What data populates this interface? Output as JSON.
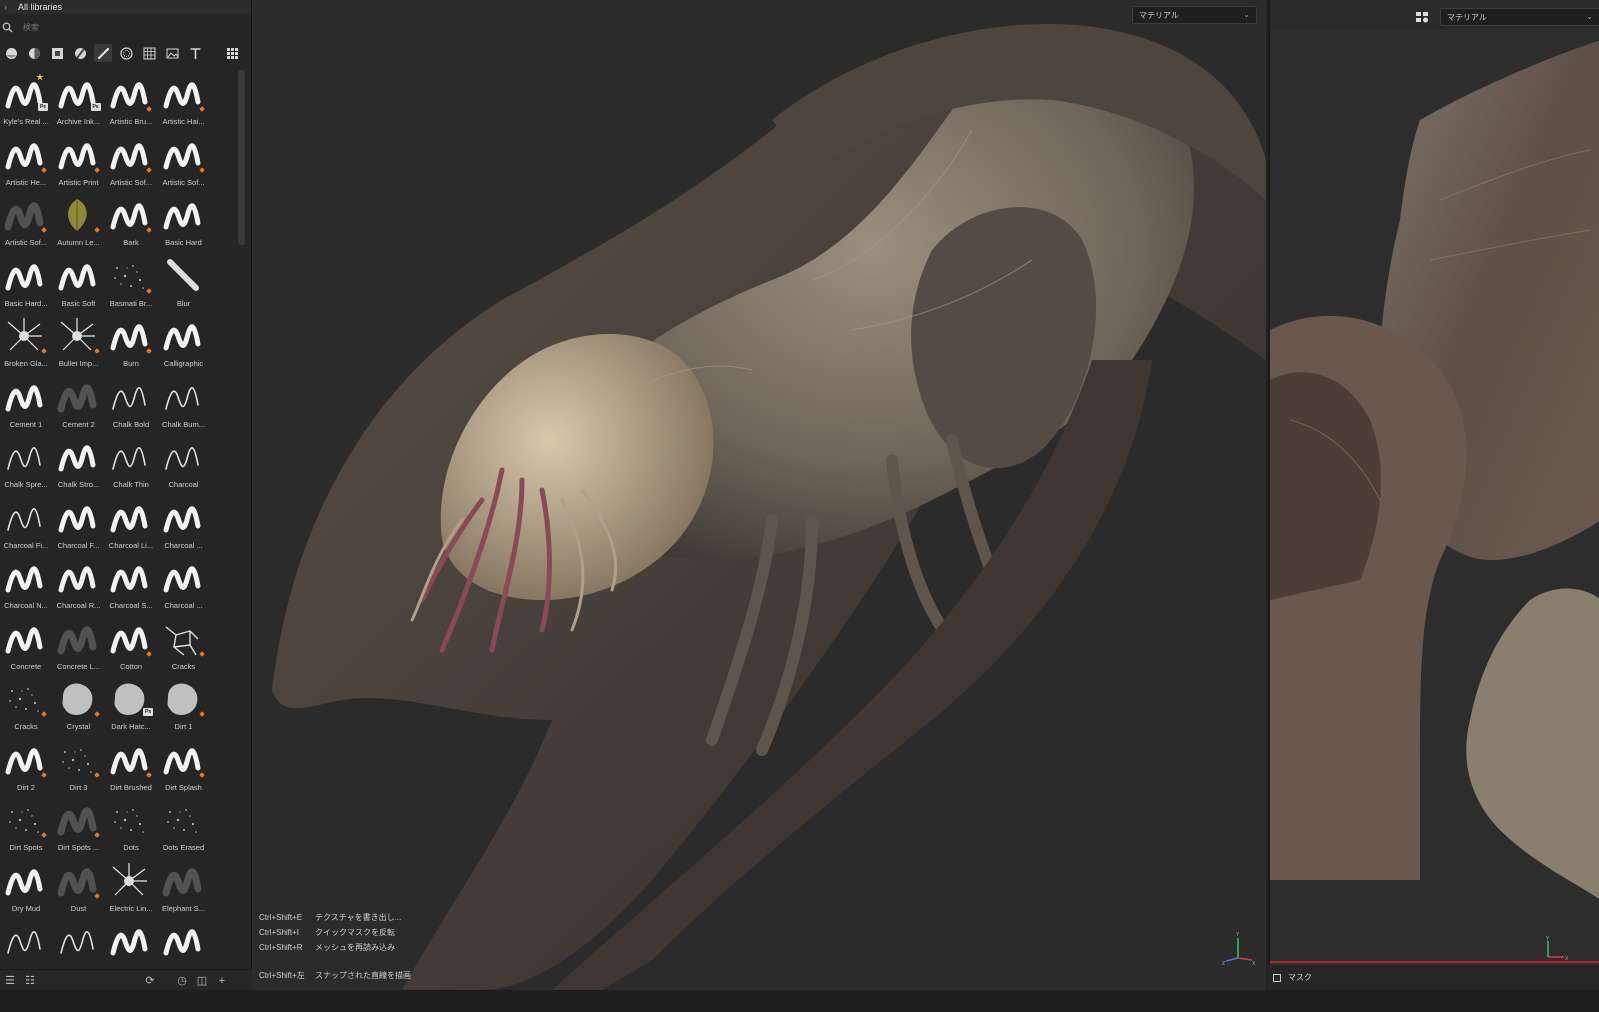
{
  "library": {
    "header": "All libraries",
    "search_placeholder": "検索",
    "tools": [
      "sphere-icon",
      "material-icon",
      "texture-icon",
      "smart-material-icon",
      "brush-icon",
      "stencil-icon",
      "grid-fill-icon",
      "image-icon",
      "text-icon"
    ],
    "items": [
      {
        "label": "Kyle's Real ...",
        "glyph": "wave",
        "badge": "ps",
        "star": true
      },
      {
        "label": "Archive Ink...",
        "glyph": "wave",
        "badge": "ps"
      },
      {
        "label": "Artistic Bru...",
        "glyph": "wave",
        "badge": "orange"
      },
      {
        "label": "Artistic Hai...",
        "glyph": "wave",
        "badge": "orange"
      },
      {
        "label": "Artistic He...",
        "glyph": "wave",
        "badge": "orange"
      },
      {
        "label": "Artistic Print",
        "glyph": "wave",
        "badge": "orange"
      },
      {
        "label": "Artistic Sof...",
        "glyph": "wave",
        "badge": "orange"
      },
      {
        "label": "Artistic Sof...",
        "glyph": "wave",
        "badge": "orange"
      },
      {
        "label": "Artistic Sof...",
        "glyph": "blur",
        "badge": "orange"
      },
      {
        "label": "Autumn Le...",
        "glyph": "leaf",
        "badge": "orange"
      },
      {
        "label": "Bark",
        "glyph": "wave",
        "badge": "orange"
      },
      {
        "label": "Basic Hard",
        "glyph": "wave",
        "badge": "none"
      },
      {
        "label": "Basic Hard...",
        "glyph": "wave",
        "badge": "none"
      },
      {
        "label": "Basic Soft",
        "glyph": "wave",
        "badge": "none"
      },
      {
        "label": "Basmati Br...",
        "glyph": "dots",
        "badge": "orange"
      },
      {
        "label": "Blur",
        "glyph": "streak",
        "badge": "none"
      },
      {
        "label": "Broken Gla...",
        "glyph": "burst",
        "badge": "orange"
      },
      {
        "label": "Bullet Imp...",
        "glyph": "burst",
        "badge": "orange"
      },
      {
        "label": "Burn",
        "glyph": "wave",
        "badge": "orange"
      },
      {
        "label": "Calligraphic",
        "glyph": "wave",
        "badge": "none"
      },
      {
        "label": "Cement 1",
        "glyph": "wave",
        "badge": "none"
      },
      {
        "label": "Cement 2",
        "glyph": "blur",
        "badge": "none"
      },
      {
        "label": "Chalk Bold",
        "glyph": "line",
        "badge": "none"
      },
      {
        "label": "Chalk Bum...",
        "glyph": "line",
        "badge": "none"
      },
      {
        "label": "Chalk Spre...",
        "glyph": "line",
        "badge": "none"
      },
      {
        "label": "Chalk Stro...",
        "glyph": "wave",
        "badge": "none"
      },
      {
        "label": "Chalk Thin",
        "glyph": "line",
        "badge": "none"
      },
      {
        "label": "Charcoal",
        "glyph": "line",
        "badge": "none"
      },
      {
        "label": "Charcoal Fi...",
        "glyph": "line",
        "badge": "none"
      },
      {
        "label": "Charcoal F...",
        "glyph": "wave",
        "badge": "none"
      },
      {
        "label": "Charcoal Li...",
        "glyph": "wave",
        "badge": "none"
      },
      {
        "label": "Charcoal ...",
        "glyph": "wave",
        "badge": "none"
      },
      {
        "label": "Charcoal N...",
        "glyph": "wave",
        "badge": "none"
      },
      {
        "label": "Charcoal R...",
        "glyph": "wave",
        "badge": "none"
      },
      {
        "label": "Charcoal S...",
        "glyph": "wave",
        "badge": "none"
      },
      {
        "label": "Charcoal ...",
        "glyph": "wave",
        "badge": "none"
      },
      {
        "label": "Concrete",
        "glyph": "wave",
        "badge": "none"
      },
      {
        "label": "Concrete L...",
        "glyph": "blur",
        "badge": "none"
      },
      {
        "label": "Cotton",
        "glyph": "wave",
        "badge": "orange"
      },
      {
        "label": "Cracks",
        "glyph": "cracks",
        "badge": "orange"
      },
      {
        "label": "Cracks",
        "glyph": "dots",
        "badge": "orange"
      },
      {
        "label": "Crystal",
        "glyph": "blob",
        "badge": "orange"
      },
      {
        "label": "Dark Hatc...",
        "glyph": "blob",
        "badge": "ps"
      },
      {
        "label": "Dirt 1",
        "glyph": "blob",
        "badge": "orange"
      },
      {
        "label": "Dirt 2",
        "glyph": "wave",
        "badge": "orange"
      },
      {
        "label": "Dirt 3",
        "glyph": "dots",
        "badge": "orange"
      },
      {
        "label": "Dirt Brushed",
        "glyph": "wave",
        "badge": "orange"
      },
      {
        "label": "Dirt Splash",
        "glyph": "wave",
        "badge": "orange"
      },
      {
        "label": "Dirt Spots",
        "glyph": "dots",
        "badge": "orange"
      },
      {
        "label": "Dirt Spots ...",
        "glyph": "blur",
        "badge": "orange"
      },
      {
        "label": "Dots",
        "glyph": "dots",
        "badge": "none"
      },
      {
        "label": "Dots Erased",
        "glyph": "dots",
        "badge": "none"
      },
      {
        "label": "Dry Mud",
        "glyph": "wave",
        "badge": "none"
      },
      {
        "label": "Dust",
        "glyph": "blur",
        "badge": "orange"
      },
      {
        "label": "Electric Lin...",
        "glyph": "burst",
        "badge": "none"
      },
      {
        "label": "Elephant S...",
        "glyph": "blur",
        "badge": "none"
      },
      {
        "label": "",
        "glyph": "line",
        "badge": "none"
      },
      {
        "label": "",
        "glyph": "line",
        "badge": "none"
      },
      {
        "label": "",
        "glyph": "wave",
        "badge": "none"
      },
      {
        "label": "",
        "glyph": "wave",
        "badge": "none"
      }
    ],
    "footer_icons": [
      "list-view-icon",
      "detail-view-icon",
      "refresh-icon",
      "history-icon",
      "folder-icon",
      "add-icon"
    ]
  },
  "viewport3d": {
    "material_dropdown": "マテリアル",
    "shortcuts": [
      {
        "keys": "Ctrl+Shift+E",
        "action": "テクスチャを書き出し..."
      },
      {
        "keys": "Ctrl+Shift+I",
        "action": "クイックマスクを反転"
      },
      {
        "keys": "Ctrl+Shift+R",
        "action": "メッシュを再読み込み"
      }
    ],
    "shortcut_last": {
      "keys": "Ctrl+Shift+左",
      "action": "スナップされた直線を描画"
    },
    "axis": {
      "y": "Y",
      "x": "X",
      "z": "Z"
    }
  },
  "viewport2d": {
    "material_dropdown": "マテリアル",
    "mask_label": "マスク",
    "axis": {
      "y": "Y",
      "x": "X"
    }
  },
  "colors": {
    "panel_bg": "#252525",
    "viewport_bg": "#2b2b2b",
    "badge_orange": "#e07a22",
    "accent_red": "#b3242a",
    "creature_flesh": "#8a7f72"
  }
}
